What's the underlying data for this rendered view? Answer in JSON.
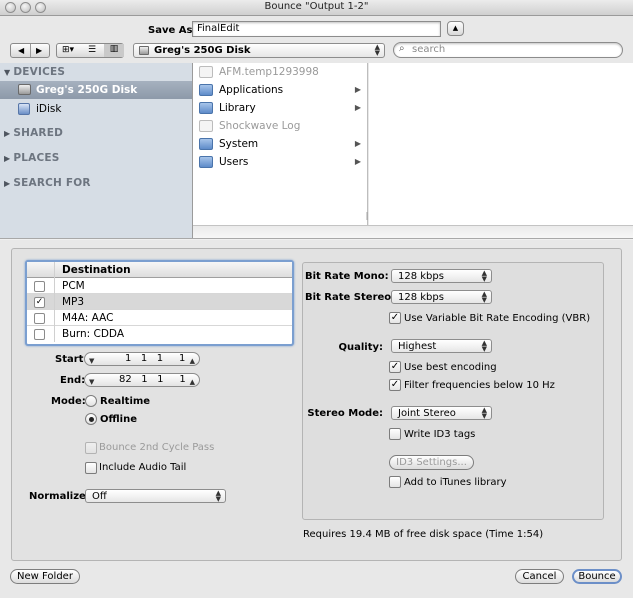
{
  "window": {
    "title": "Bounce \"Output 1-2\""
  },
  "save_as": {
    "label": "Save As:",
    "value": "FinalEdit"
  },
  "toolbar": {
    "location": "Greg's 250G Disk",
    "search_placeholder": "search"
  },
  "sidebar": {
    "devices_header": "DEVICES",
    "devices": [
      "Greg's 250G Disk",
      "iDisk"
    ],
    "shared_header": "SHARED",
    "places_header": "PLACES",
    "search_header": "SEARCH FOR"
  },
  "files": [
    {
      "name": "AFM.temp1293998",
      "kind": "doc",
      "dim": true,
      "folder": false
    },
    {
      "name": "Applications",
      "kind": "folder",
      "dim": false,
      "folder": true
    },
    {
      "name": "Library",
      "kind": "folder",
      "dim": false,
      "folder": true
    },
    {
      "name": "Shockwave Log",
      "kind": "doc",
      "dim": true,
      "folder": false
    },
    {
      "name": "System",
      "kind": "folder",
      "dim": false,
      "folder": true
    },
    {
      "name": "Users",
      "kind": "folder",
      "dim": false,
      "folder": true
    }
  ],
  "destination": {
    "header": "Destination",
    "rows": [
      {
        "label": "PCM",
        "checked": false
      },
      {
        "label": "MP3",
        "checked": true
      },
      {
        "label": "M4A: AAC",
        "checked": false
      },
      {
        "label": "Burn: CDDA",
        "checked": false
      }
    ]
  },
  "range": {
    "start_label": "Start:",
    "start_value": "1   1   1     1",
    "end_label": "End:",
    "end_value": "82   1   1     1"
  },
  "mode": {
    "label": "Mode:",
    "realtime": "Realtime",
    "offline": "Offline",
    "selected": "offline"
  },
  "options": {
    "bounce_2nd": "Bounce 2nd Cycle Pass",
    "include_tail": "Include Audio Tail",
    "normalize_label": "Normalize:",
    "normalize_value": "Off"
  },
  "mp3": {
    "bitrate_mono_label": "Bit Rate Mono:",
    "bitrate_mono_value": "128 kbps",
    "bitrate_stereo_label": "Bit Rate Stereo:",
    "bitrate_stereo_value": "128 kbps",
    "vbr_label": "Use Variable Bit Rate Encoding (VBR)",
    "vbr_checked": true,
    "quality_label": "Quality:",
    "quality_value": "Highest",
    "best_label": "Use best encoding",
    "best_checked": true,
    "filter_label": "Filter frequencies below 10 Hz",
    "filter_checked": true,
    "stereo_mode_label": "Stereo Mode:",
    "stereo_mode_value": "Joint Stereo",
    "id3_label": "Write ID3 tags",
    "id3_checked": false,
    "id3_settings": "ID3 Settings...",
    "itunes_label": "Add to iTunes library",
    "itunes_checked": false
  },
  "status": "Requires 19.4 MB of free disk space  (Time 1:54)",
  "buttons": {
    "new_folder": "New Folder",
    "cancel": "Cancel",
    "bounce": "Bounce"
  }
}
